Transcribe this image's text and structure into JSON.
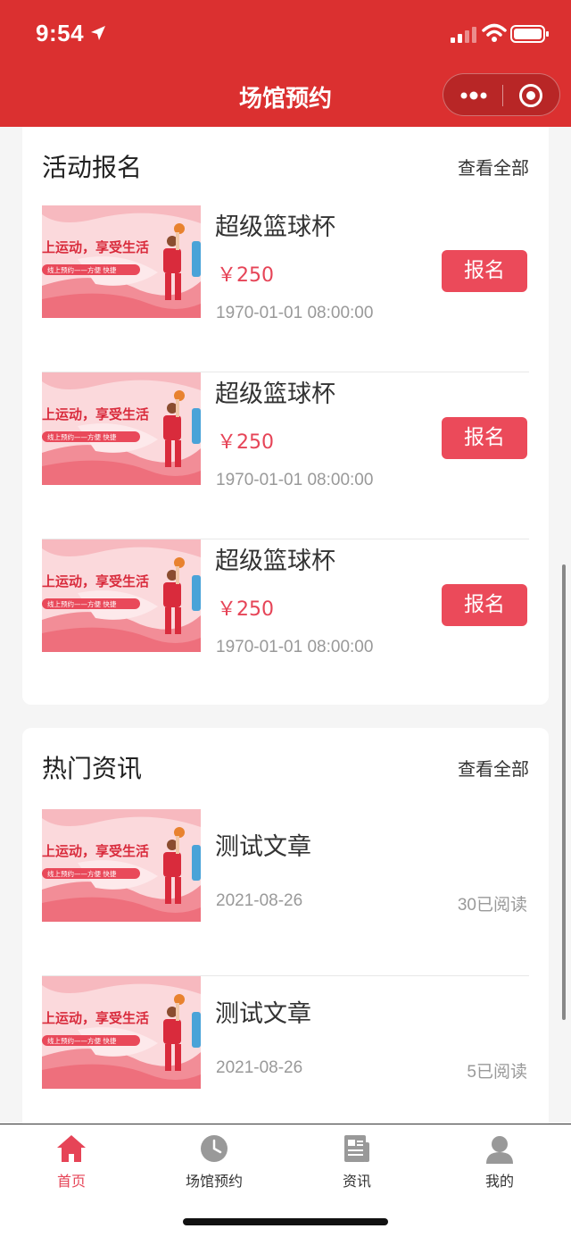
{
  "status_bar": {
    "time": "9:54"
  },
  "nav": {
    "title": "场馆预约"
  },
  "activity": {
    "title": "活动报名",
    "more": "查看全部",
    "items": [
      {
        "banner_main": "上运动，享受生活",
        "banner_sub": "线上预约——方便 快捷",
        "title": "超级篮球杯",
        "price": "￥250",
        "time": "1970-01-01 08:00:00",
        "button": "报名"
      },
      {
        "banner_main": "上运动，享受生活",
        "banner_sub": "线上预约——方便 快捷",
        "title": "超级篮球杯",
        "price": "￥250",
        "time": "1970-01-01 08:00:00",
        "button": "报名"
      },
      {
        "banner_main": "上运动，享受生活",
        "banner_sub": "线上预约——方便 快捷",
        "title": "超级篮球杯",
        "price": "￥250",
        "time": "1970-01-01 08:00:00",
        "button": "报名"
      }
    ]
  },
  "news": {
    "title": "热门资讯",
    "more": "查看全部",
    "items": [
      {
        "banner_main": "上运动，享受生活",
        "banner_sub": "线上预约——方便 快捷",
        "title": "测试文章",
        "date": "2021-08-26",
        "reads": "30已阅读"
      },
      {
        "banner_main": "上运动，享受生活",
        "banner_sub": "线上预约——方便 快捷",
        "title": "测试文章",
        "date": "2021-08-26",
        "reads": "5已阅读"
      }
    ]
  },
  "tabbar": {
    "items": [
      {
        "label": "首页",
        "icon": "home-icon",
        "active": true
      },
      {
        "label": "场馆预约",
        "icon": "clock-icon",
        "active": false
      },
      {
        "label": "资讯",
        "icon": "news-icon",
        "active": false
      },
      {
        "label": "我的",
        "icon": "user-icon",
        "active": false
      }
    ]
  },
  "colors": {
    "header": "#db3030",
    "accent": "#eb4a5a",
    "price": "#e64457"
  }
}
